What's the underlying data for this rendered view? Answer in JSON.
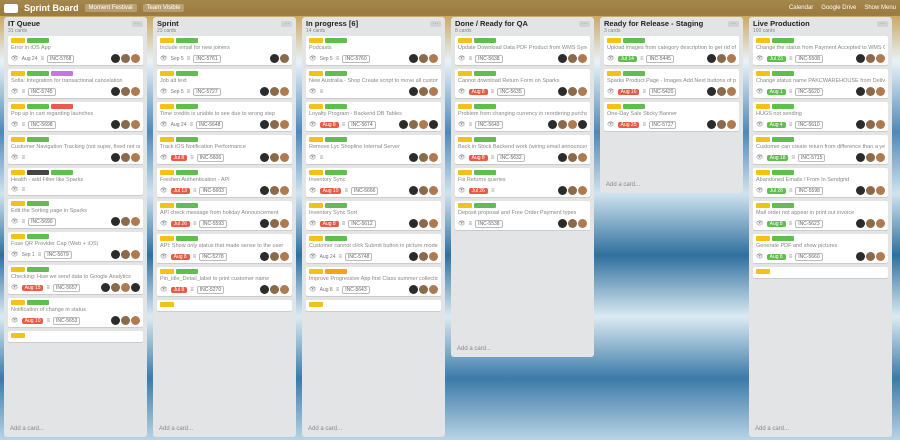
{
  "header": {
    "title": "Sprint Board",
    "tag": "Moment Festival",
    "team": "Team Visible",
    "calendar": "Calendar",
    "drive": "Google Drive",
    "menu": "Show Menu"
  },
  "add_card_label": "Add a card...",
  "lists": [
    {
      "title": "IT Queue",
      "subtitle": "31 cards",
      "cards": [
        {
          "labels": [
            "y",
            "g"
          ],
          "title": "Error in iOS App",
          "due": "Aug 24",
          "due_style": "plain",
          "ref": "INC-5768",
          "avatars": 3
        },
        {
          "labels": [
            "y",
            "g",
            "p"
          ],
          "title": "Sofia: Integration for transactional cancelation",
          "due": "",
          "due_style": "",
          "ref": "INC-5745",
          "avatars": 3
        },
        {
          "labels": [
            "y",
            "g",
            "r"
          ],
          "title": "Pop up in cart regarding launches",
          "due": "",
          "due_style": "",
          "ref": "INC-5698",
          "avatars": 3
        },
        {
          "labels": [
            "y",
            "g"
          ],
          "title": "Customer Navigation Tracking (not super, fixed not only)",
          "due": "",
          "due_style": "",
          "ref": "",
          "avatars": 3
        },
        {
          "labels": [
            "y",
            "d",
            "g"
          ],
          "title": "Health - add Filter like Sparks",
          "due": "",
          "due_style": "",
          "ref": "",
          "avatars": 0
        },
        {
          "labels": [
            "y",
            "g"
          ],
          "title": "Edit the Sorting page in Sparks",
          "due": "",
          "due_style": "",
          "ref": "INC-5690",
          "avatars": 3
        },
        {
          "labels": [
            "y",
            "g"
          ],
          "title": "Fuse QR Provider Cap (Web + iOS)",
          "due": "Sep 1",
          "due_style": "plain",
          "ref": "INC-5679",
          "avatars": 3
        },
        {
          "labels": [
            "y",
            "g"
          ],
          "title": "Checking: How we send data to Google Analytics",
          "due": "Aug 15",
          "due_style": "red",
          "ref": "INC-5657",
          "avatars": 4
        },
        {
          "labels": [
            "y",
            "g"
          ],
          "title": "Notification of change in status",
          "due": "Aug 10",
          "due_style": "red",
          "ref": "INC-5653",
          "avatars": 3
        },
        {
          "labels": [
            "y"
          ],
          "title": "",
          "due": "",
          "due_style": "",
          "ref": "",
          "avatars": 0
        }
      ]
    },
    {
      "title": "Sprint",
      "subtitle": "23 cards",
      "cards": [
        {
          "labels": [
            "y",
            "g"
          ],
          "title": "Include email for new joiners",
          "due": "Sep 5",
          "due_style": "plain",
          "ref": "INC-5761",
          "avatars": 2
        },
        {
          "labels": [
            "y",
            "g"
          ],
          "title": "Job alt text",
          "due": "Sep 5",
          "due_style": "plain",
          "ref": "INC-5727",
          "avatars": 3
        },
        {
          "labels": [
            "y",
            "g"
          ],
          "title": "Time credits is unable to see due to wrong step",
          "due": "Aug 24",
          "due_style": "plain",
          "ref": "INC-5648",
          "avatars": 3
        },
        {
          "labels": [
            "y",
            "g"
          ],
          "title": "Track iOS Notification Performance",
          "due": "Jul 8",
          "due_style": "red",
          "ref": "INC-5606",
          "avatars": 3
        },
        {
          "labels": [
            "y",
            "g"
          ],
          "title": "Freshen Authentication - API",
          "due": "Jul 13",
          "due_style": "red",
          "ref": "INC-5603",
          "avatars": 3
        },
        {
          "labels": [
            "y",
            "g"
          ],
          "title": "API check message from holiday Announcement",
          "due": "Jul 26",
          "due_style": "red",
          "ref": "INC-5593",
          "avatars": 3
        },
        {
          "labels": [
            "y",
            "g"
          ],
          "title": "API: Show only status that made sense to the user",
          "due": "Aug 8",
          "due_style": "red",
          "ref": "INC-5278",
          "avatars": 3
        },
        {
          "labels": [
            "y",
            "g"
          ],
          "title": "Pin_idle_Detail_label to print customer name",
          "due": "Jul 8",
          "due_style": "red",
          "ref": "INC-5270",
          "avatars": 3
        },
        {
          "labels": [
            "y"
          ],
          "title": "",
          "due": "",
          "due_style": "",
          "ref": "",
          "avatars": 0
        }
      ]
    },
    {
      "title": "In progress [6]",
      "subtitle": "14 cards",
      "cards": [
        {
          "labels": [
            "y",
            "g"
          ],
          "title": "Podcasts",
          "due": "Sep 5",
          "due_style": "plain",
          "ref": "INC-5760",
          "avatars": 3
        },
        {
          "labels": [
            "y",
            "g"
          ],
          "title": "New Australia - Shop Create script to move all customers and orders from Australia to global shop into the new shop (B)",
          "due": "",
          "due_style": "",
          "ref": "",
          "avatars": 3
        },
        {
          "labels": [
            "y",
            "g"
          ],
          "title": "Loyalty Program - Backend DB Tables",
          "due": "Aug 8",
          "due_style": "red",
          "ref": "INC-5674",
          "avatars": 4
        },
        {
          "labels": [
            "y",
            "g"
          ],
          "title": "Remove Lyc Shopline Internal Server",
          "due": "",
          "due_style": "",
          "ref": "",
          "avatars": 3
        },
        {
          "labels": [
            "y",
            "g"
          ],
          "title": "Inventory Sync",
          "due": "Aug 10",
          "due_style": "red",
          "ref": "INC-5666",
          "avatars": 3
        },
        {
          "labels": [
            "y",
            "g"
          ],
          "title": "Inventory Sync Sort",
          "due": "Aug 8",
          "due_style": "red",
          "ref": "INC-5612",
          "avatars": 3
        },
        {
          "labels": [
            "y",
            "g"
          ],
          "title": "Customer cannot click Submit button in picture mode when checking out",
          "due": "Aug 24",
          "due_style": "plain",
          "ref": "INC-5748",
          "avatars": 3
        },
        {
          "labels": [
            "y",
            "o"
          ],
          "title": "Improve Progressive App first Class summer collection code",
          "due": "Aug 8",
          "due_style": "plain",
          "ref": "INC-5643",
          "avatars": 3
        },
        {
          "labels": [
            "y"
          ],
          "title": "",
          "due": "",
          "due_style": "",
          "ref": "",
          "avatars": 0
        }
      ]
    },
    {
      "title": "Done / Ready for QA",
      "subtitle": "8 cards",
      "cards": [
        {
          "labels": [
            "y",
            "g"
          ],
          "title": "Update Download Data PDF Product from WMS Sync Download PDF button",
          "due": "",
          "due_style": "",
          "ref": "INC-5638",
          "avatars": 3
        },
        {
          "labels": [
            "y",
            "g"
          ],
          "title": "Cannot download Return Form on Sparks",
          "due": "Aug 8",
          "due_style": "red",
          "ref": "INC-5635",
          "avatars": 3
        },
        {
          "labels": [
            "y",
            "g"
          ],
          "title": "Problem from changing currency in reordering purchase",
          "due": "",
          "due_style": "",
          "ref": "INC-5643",
          "avatars": 4
        },
        {
          "labels": [
            "y",
            "g"
          ],
          "title": "Back in Stock Backend work (wiring email announcement for out of stk)",
          "due": "Aug 8",
          "due_style": "red",
          "ref": "INC-5632",
          "avatars": 3
        },
        {
          "labels": [
            "y",
            "g"
          ],
          "title": "Fix Returns queries",
          "due": "Jul 26",
          "due_style": "red",
          "ref": "",
          "avatars": 3
        },
        {
          "labels": [
            "y",
            "g"
          ],
          "title": "Deposit proposal and Free Order Payment types",
          "due": "",
          "due_style": "",
          "ref": "INC-5538",
          "avatars": 3
        }
      ]
    },
    {
      "title": "Ready for Release - Staging",
      "subtitle": "3 cards",
      "cards": [
        {
          "labels": [
            "y",
            "g"
          ],
          "title": "Upload images from category description to get rid of unlinked images",
          "due": "Jul 14",
          "due_style": "green",
          "ref": "INC-5445",
          "avatars": 3
        },
        {
          "labels": [
            "y",
            "g"
          ],
          "title": "Sparks Product Page - Images Add Next buttons of product images as we don't have to open and close the each image",
          "due": "Aug 16",
          "due_style": "red",
          "ref": "INC-5420",
          "avatars": 3
        },
        {
          "labels": [
            "y",
            "g"
          ],
          "title": "One-Day Sale Sticky Banner",
          "due": "Aug 25",
          "due_style": "red",
          "ref": "INC-5727",
          "avatars": 3
        }
      ]
    },
    {
      "title": "Live Production",
      "subtitle": "100 cards",
      "cards": [
        {
          "labels": [
            "y",
            "g"
          ],
          "title": "Change the status from Payment Accepted to WMS Ordered",
          "due": "Jul 23",
          "due_style": "green",
          "ref": "INC-5508",
          "avatars": 3
        },
        {
          "labels": [
            "y",
            "g"
          ],
          "title": "Change status name PAKCWAREHOUSE from Delivered to Shipped",
          "due": "Aug 1",
          "due_style": "green",
          "ref": "INC-5620",
          "avatars": 3
        },
        {
          "labels": [
            "y",
            "g"
          ],
          "title": "HUGS not sending",
          "due": "Aug 4",
          "due_style": "green",
          "ref": "INC-5610",
          "avatars": 3
        },
        {
          "labels": [
            "y",
            "g"
          ],
          "title": "Customer can create return from difference than a year of her order",
          "due": "Aug 18",
          "due_style": "green",
          "ref": "INC-5715",
          "avatars": 3
        },
        {
          "labels": [
            "y",
            "g"
          ],
          "title": "Abandoned Emails / From In Sendgrid",
          "due": "Jul 28",
          "due_style": "green",
          "ref": "INC-5598",
          "avatars": 3
        },
        {
          "labels": [
            "y",
            "g"
          ],
          "title": "Mail order not appear in print out invoice",
          "due": "Aug 8",
          "due_style": "green",
          "ref": "INC-5623",
          "avatars": 3
        },
        {
          "labels": [
            "y",
            "g"
          ],
          "title": "Generate PDF and show pictures",
          "due": "Aug 8",
          "due_style": "green",
          "ref": "INC-5660",
          "avatars": 3
        },
        {
          "labels": [
            "y"
          ],
          "title": "",
          "due": "",
          "due_style": "",
          "ref": "",
          "avatars": 0
        }
      ]
    }
  ]
}
